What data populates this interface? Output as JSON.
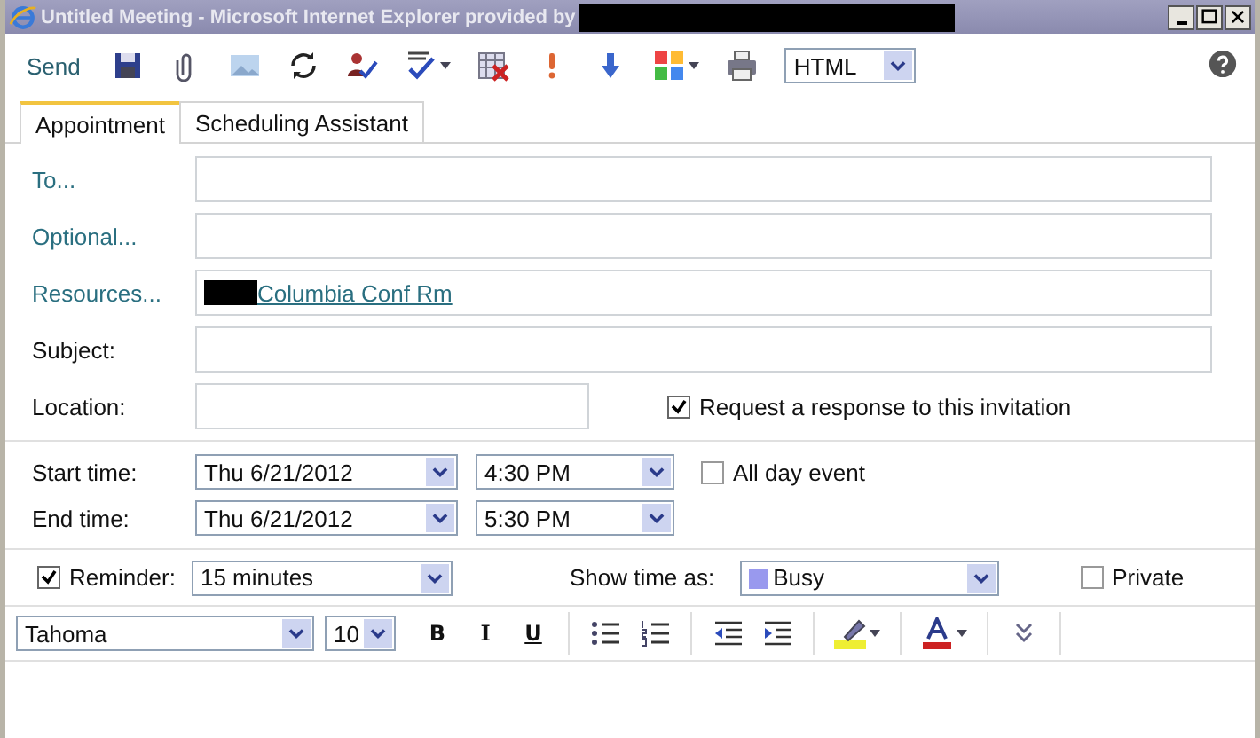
{
  "window": {
    "title": "Untitled Meeting - Microsoft Internet Explorer provided by"
  },
  "toolbar": {
    "items": [
      {
        "kind": "text",
        "label": "Send"
      },
      {
        "kind": "select",
        "value": "HTML"
      }
    ]
  },
  "tabs": [
    {
      "label": "Appointment",
      "selected": true
    },
    {
      "label": "Scheduling Assistant",
      "selected": false
    }
  ],
  "fields": [
    {
      "label": "To...",
      "kind": "link"
    },
    {
      "label": "Optional...",
      "kind": "link"
    },
    {
      "label": "Resources...",
      "kind": "link",
      "value": "Columbia Conf Rm"
    },
    {
      "label": "Subject:",
      "kind": "plain"
    }
  ],
  "location": {
    "label": "Location:",
    "request": {
      "label": "Request a response to this invitation",
      "checked": true
    }
  },
  "times": [
    {
      "label": "Start time:",
      "date": "Thu 6/21/2012",
      "time": "4:30 PM"
    },
    {
      "label": "End time:",
      "date": "Thu 6/21/2012",
      "time": "5:30 PM"
    }
  ],
  "all_day": {
    "label": "All day event",
    "checked": false
  },
  "reminder": {
    "label": "Reminder:",
    "checked": true,
    "value": "15 minutes"
  },
  "show_time_as": {
    "label": "Show time as:",
    "value": "Busy",
    "color": "#9999ee"
  },
  "private": {
    "label": "Private",
    "checked": false
  },
  "format_bar": {
    "font": "Tahoma",
    "size": "10",
    "buttons": [
      {
        "kind": "bold",
        "label": "B"
      },
      {
        "kind": "italic",
        "label": "I"
      },
      {
        "kind": "underline",
        "label": "U"
      }
    ]
  }
}
